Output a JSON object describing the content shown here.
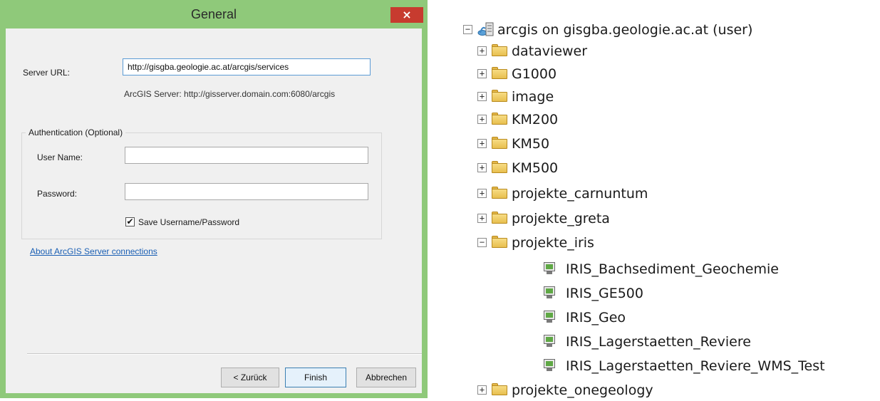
{
  "dialog": {
    "title": "General",
    "close_glyph": "×",
    "server_url_label": "Server URL:",
    "server_url_value": "http://gisgba.geologie.ac.at/arcgis/services",
    "server_url_hint": "ArcGIS Server: http://gisserver.domain.com:6080/arcgis",
    "auth_group_title": "Authentication (Optional)",
    "username_label": "User Name:",
    "username_value": "",
    "password_label": "Password:",
    "password_value": "",
    "save_credentials_label": "Save Username/Password",
    "save_credentials_checked": true,
    "check_glyph": "✔",
    "about_link": "About ArcGIS Server connections",
    "buttons": {
      "back": "< Zurück",
      "finish": "Finish",
      "cancel": "Abbrechen"
    },
    "colors": {
      "title_bar": "#8fc97a",
      "close_button": "#c73b2f",
      "link": "#1a5fb4"
    }
  },
  "tree": {
    "expanded_glyph": "−",
    "collapsed_glyph": "+",
    "root": {
      "label": "arcgis on gisgba.geologie.ac.at (user)",
      "icon": "server-connection-icon"
    },
    "folders": [
      "dataviewer",
      "G1000",
      "image",
      "KM200",
      "KM50",
      "KM500",
      "projekte_carnuntum",
      "projekte_greta",
      "projekte_iris"
    ],
    "services": [
      "IRIS_Bachsediment_Geochemie",
      "IRIS_GE500",
      "IRIS_Geo",
      "IRIS_Lagerstaetten_Reviere",
      "IRIS_Lagerstaetten_Reviere_WMS_Test"
    ],
    "trailing_folder": "projekte_onegeology"
  }
}
